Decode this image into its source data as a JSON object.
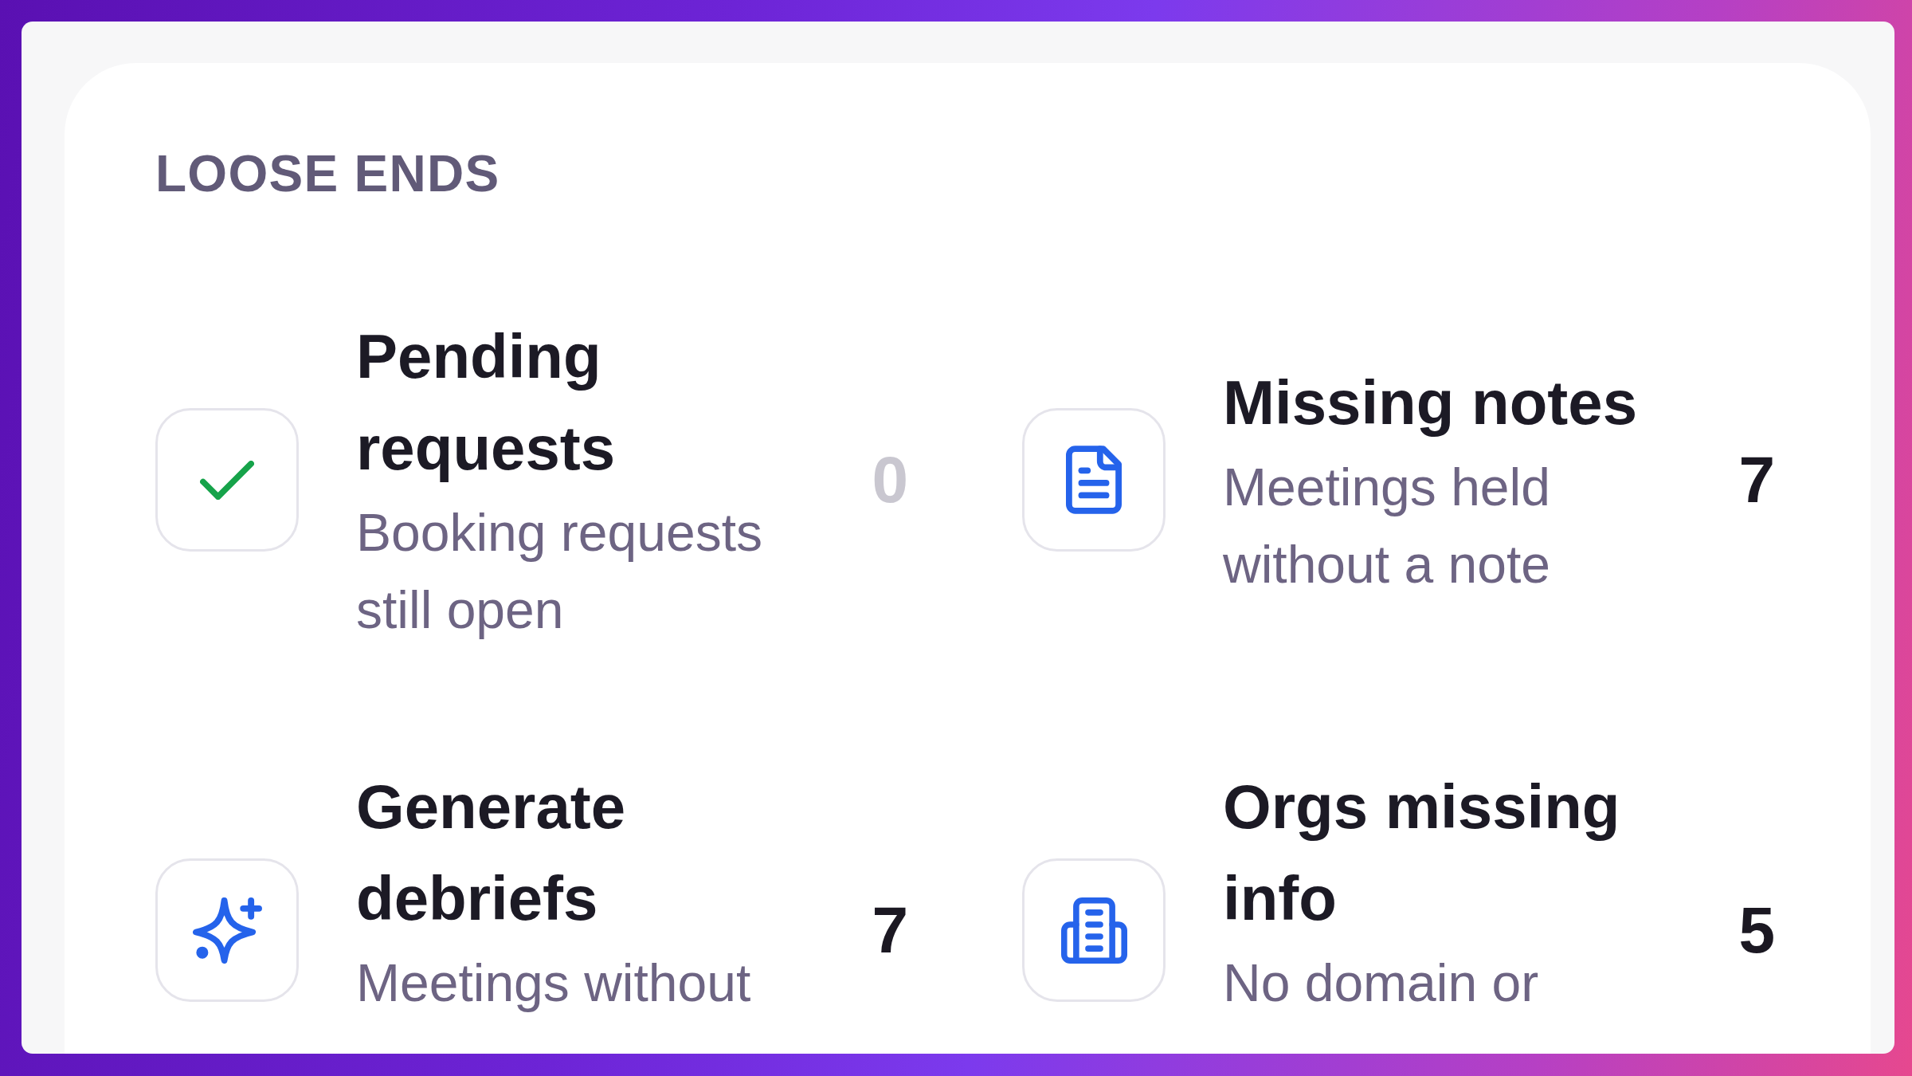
{
  "panel": {
    "title": "LOOSE ENDS"
  },
  "items": [
    {
      "kind": "check",
      "color": "#16a34a",
      "title": "Pending requests",
      "description": "Booking requests still open",
      "count": "0",
      "muted": true
    },
    {
      "kind": "document",
      "color": "#2563eb",
      "title": "Missing notes",
      "description": "Meetings held without a note",
      "count": "7",
      "muted": false
    },
    {
      "kind": "sparkle",
      "color": "#2563eb",
      "title": "Generate debriefs",
      "description": "Meetings without",
      "count": "7",
      "muted": false
    },
    {
      "kind": "building",
      "color": "#2563eb",
      "title": "Orgs missing info",
      "description": "No domain or",
      "count": "5",
      "muted": false
    }
  ]
}
